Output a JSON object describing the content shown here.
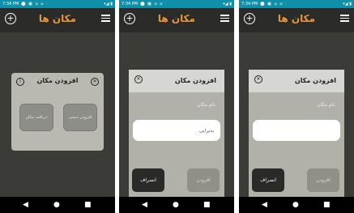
{
  "status_bar": {
    "time": "7:34 PM",
    "system_icons": "▾◢ ▮"
  },
  "screens": [
    {
      "app_title": "مکان ها",
      "dialog": {
        "title": "افزودن مکان",
        "option_manual": "افزودن دستی",
        "option_fetch": "دریافت مکان"
      }
    },
    {
      "app_title": "مکان ها",
      "dialog": {
        "title": "افزودن مکان",
        "field_label": "نام مکان:",
        "field_value": "پذیرایی",
        "add_label": "افزودن",
        "cancel_label": "انصراف"
      }
    },
    {
      "app_title": "مکان ها",
      "dialog": {
        "title": "افزودن مکان",
        "field_label": "نام مکان:",
        "field_value": "",
        "add_label": "افزودن",
        "cancel_label": "انصراف"
      }
    }
  ],
  "icons": {
    "add": "add-circle-icon",
    "menu": "hamburger-menu-icon",
    "info": "info-icon",
    "close": "close-circle-icon",
    "nav_back": "back-triangle-icon",
    "nav_home": "home-dot-icon",
    "nav_recent": "recent-square-icon"
  },
  "colors": {
    "status_bar": "#0f8fa8",
    "app_bar": "#2b2b29",
    "title_accent": "#e8963a",
    "background": "#3b3b38",
    "dialog": "#b1b1aa",
    "cancel_button": "#2a2a28"
  }
}
